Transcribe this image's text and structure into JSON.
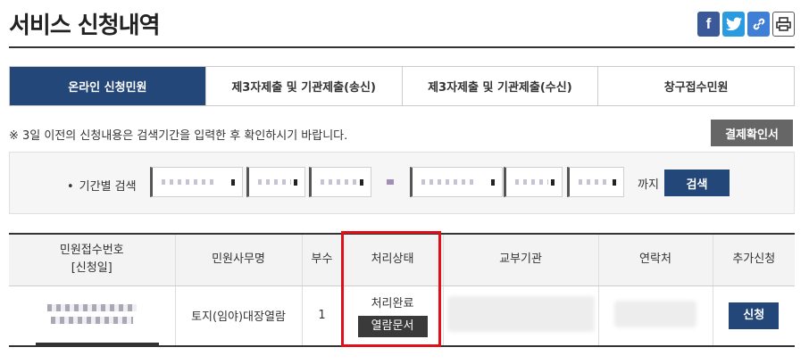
{
  "page": {
    "title": "서비스 신청내역"
  },
  "share": [
    "facebook-icon",
    "twitter-icon",
    "link-icon",
    "print-icon"
  ],
  "tabs": [
    {
      "label": "온라인 신청민원",
      "active": true
    },
    {
      "label": "제3자제출 및 기관제출(송신)",
      "active": false
    },
    {
      "label": "제3자제출 및 기관제출(수신)",
      "active": false
    },
    {
      "label": "창구접수민원",
      "active": false
    }
  ],
  "notice": "※ 3일 이전의 신청내용은 검색기간을 입력한 후 확인하시기 바랍니다.",
  "confirm_button": "결제확인서",
  "search": {
    "label": "기간별 검색",
    "until": "까지",
    "button": "검색"
  },
  "table": {
    "headers": [
      "민원접수번호",
      "[신청일]",
      "민원사무명",
      "부수",
      "처리상태",
      "교부기관",
      "연락처",
      "추가신청"
    ],
    "rows": [
      {
        "affair_name": "토지(임야)대장열람",
        "copies": "1",
        "status": "처리완료",
        "view_button": "열람문서",
        "apply_button": "신청"
      }
    ]
  },
  "colors": {
    "accent": "#24477a",
    "highlight": "#e0101a"
  }
}
